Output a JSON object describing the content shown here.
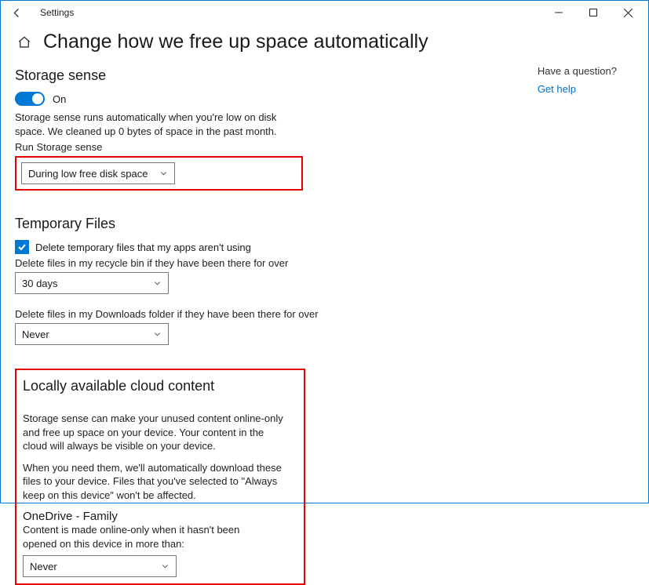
{
  "app_title": "Settings",
  "page_title": "Change how we free up space automatically",
  "rightpane": {
    "question": "Have a question?",
    "help_link": "Get help"
  },
  "storage_sense": {
    "heading": "Storage sense",
    "toggle_label": "On",
    "desc": "Storage sense runs automatically when you're low on disk space. We cleaned up 0 bytes of space in the past month.",
    "run_label": "Run Storage sense",
    "run_value": "During low free disk space"
  },
  "temp_files": {
    "heading": "Temporary Files",
    "delete_temp_label": "Delete temporary files that my apps aren't using",
    "recycle_label": "Delete files in my recycle bin if they have been there for over",
    "recycle_value": "30 days",
    "downloads_label": "Delete files in my Downloads folder if they have been there for over",
    "downloads_value": "Never"
  },
  "cloud": {
    "heading": "Locally available cloud content",
    "desc1": "Storage sense can make your unused content online-only and free up space on your device. Your content in the cloud will always be visible on your device.",
    "desc2": "When you need them, we'll automatically download these files to your device. Files that you've selected to \"Always keep on this device\" won't be affected.",
    "onedrive_heading": "OneDrive - Family",
    "onedrive_desc": "Content is made online-only when it hasn't been opened on this device in more than:",
    "onedrive_value": "Never"
  }
}
